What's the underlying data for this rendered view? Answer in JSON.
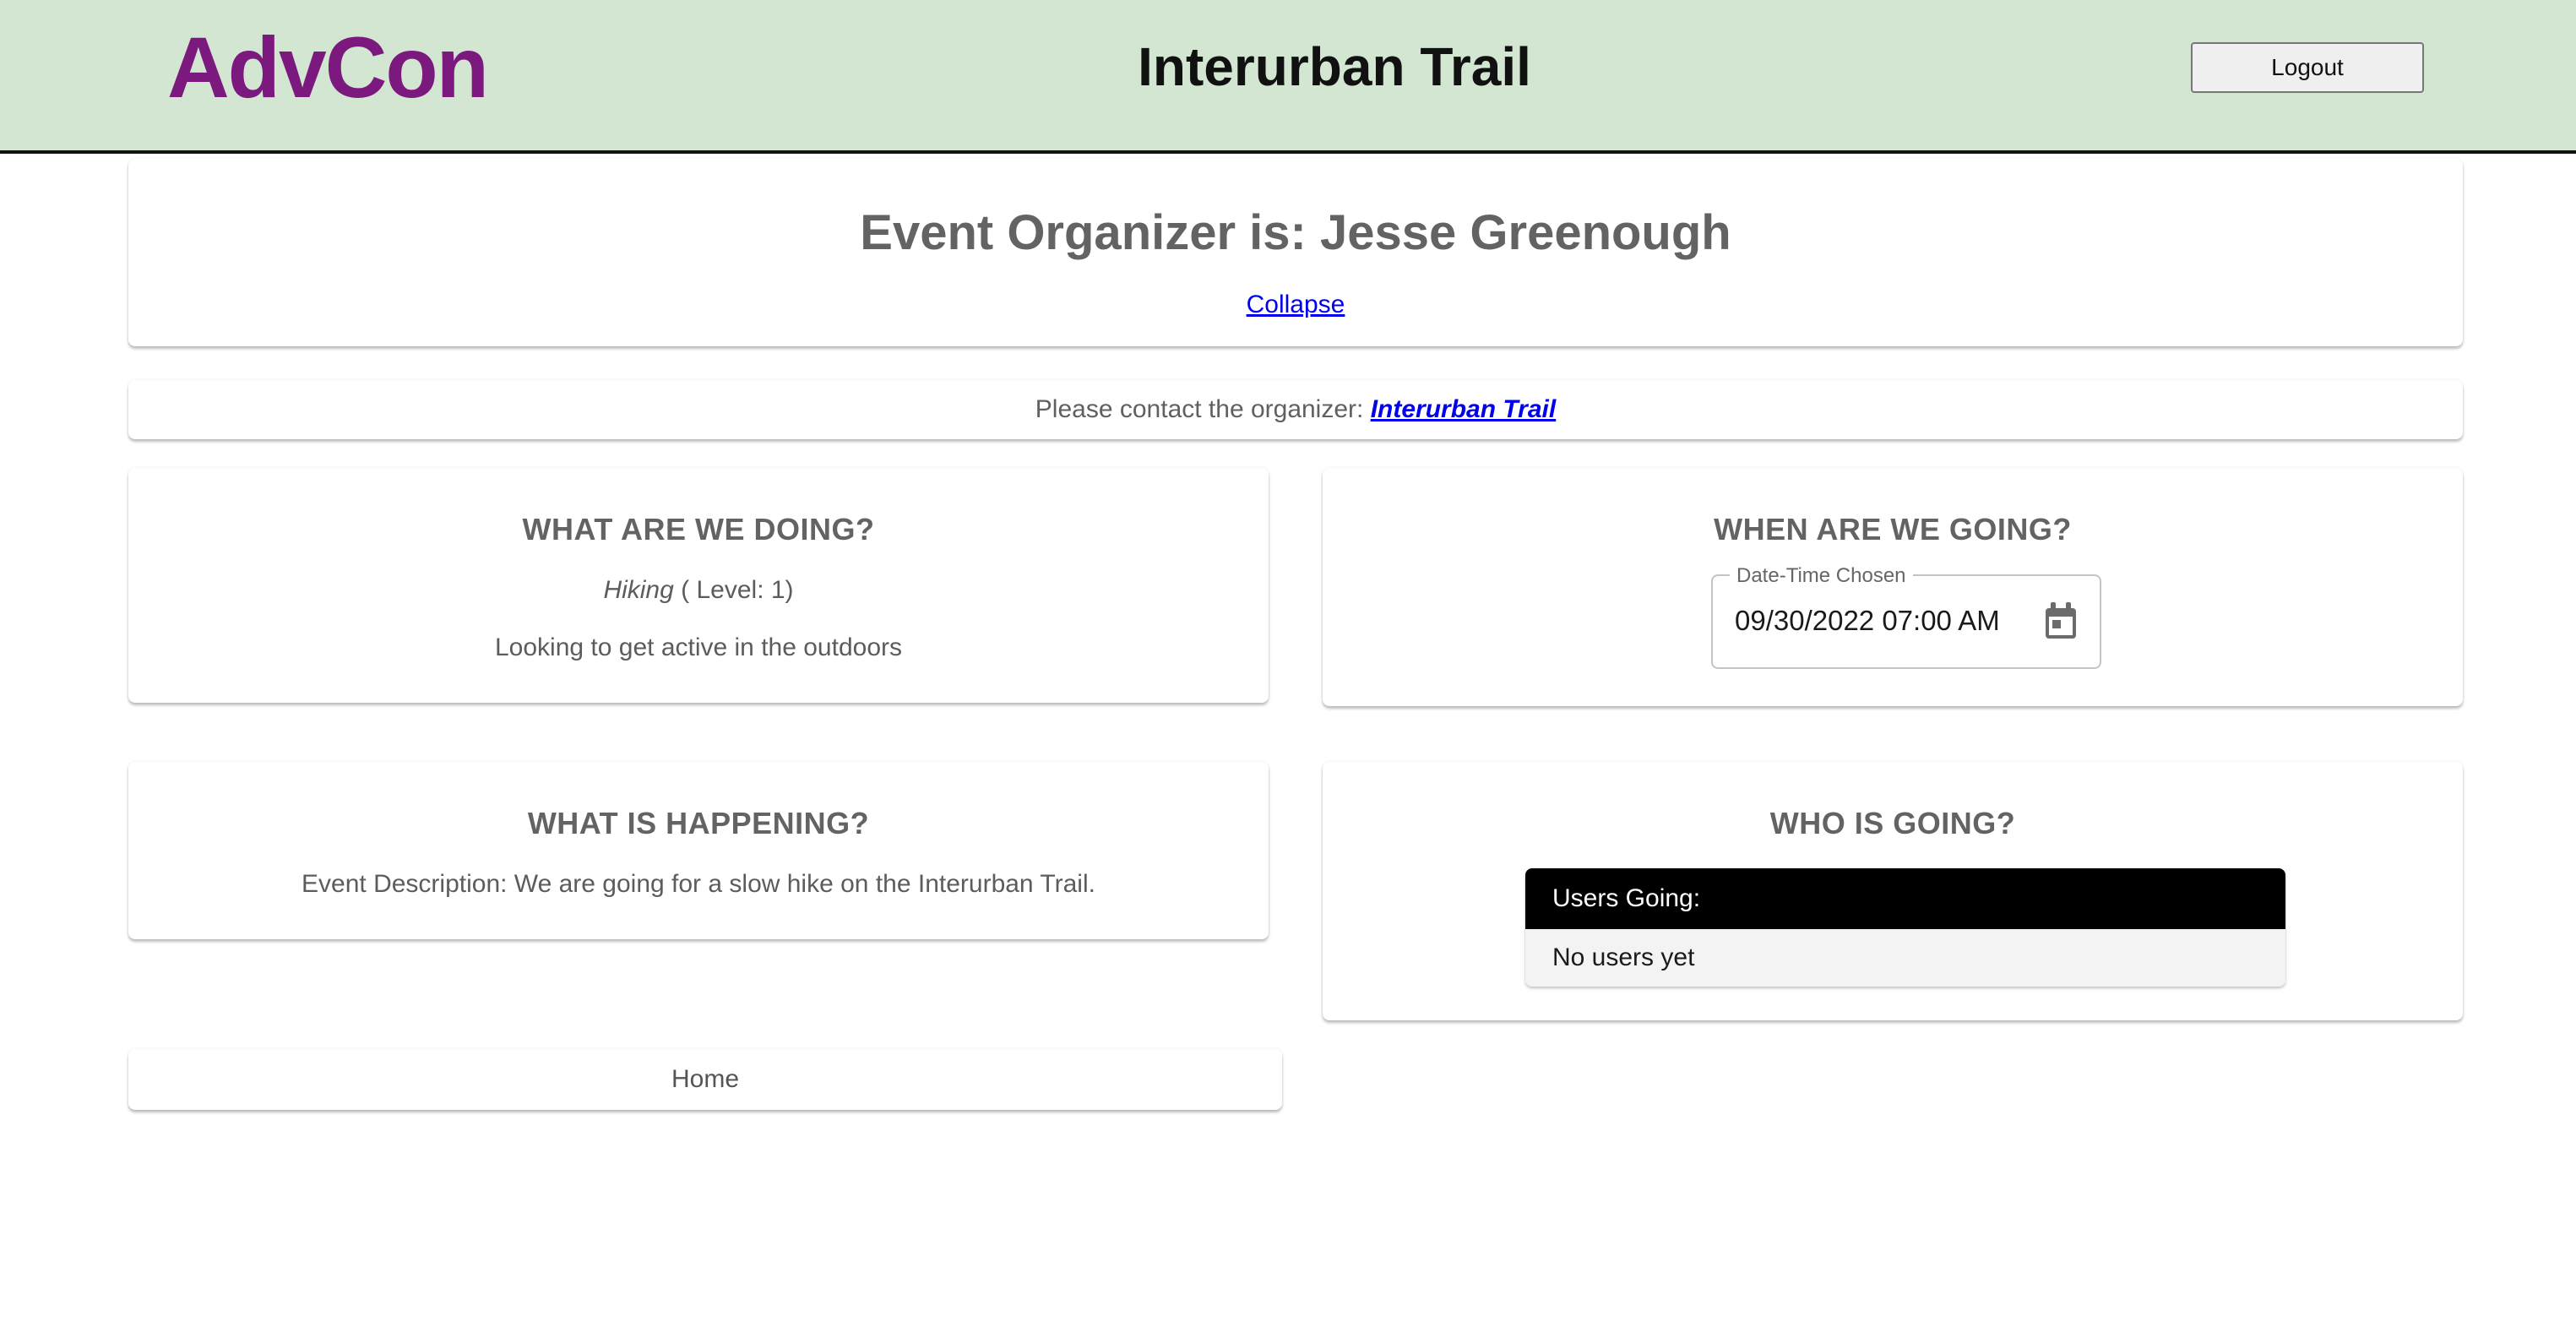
{
  "header": {
    "brand": "AdvCon",
    "title": "Interurban Trail",
    "logout_label": "Logout"
  },
  "organizer": {
    "heading": "Event Organizer is: Jesse Greenough",
    "collapse_label": "Collapse"
  },
  "contact": {
    "prefix": "Please contact the organizer: ",
    "link_label": "Interurban Trail"
  },
  "doing": {
    "title": "WHAT ARE WE DOING?",
    "activity": "Hiking",
    "level": " ( Level: 1)",
    "description": "Looking to get active in the outdoors"
  },
  "when": {
    "title": "WHEN ARE WE GOING?",
    "field_label": "Date-Time Chosen",
    "field_value": "09/30/2022 07:00 AM",
    "icon": "calendar-icon"
  },
  "happening": {
    "title": "WHAT IS HAPPENING?",
    "description": "Event Description: We are going for a slow hike on the Interurban Trail."
  },
  "who": {
    "title": "WHO IS GOING?",
    "table_header": "Users Going:",
    "empty_text": "No users yet"
  },
  "footer": {
    "home_label": "Home"
  },
  "colors": {
    "header_bg": "#d2e6d2",
    "brand": "#7b197e",
    "link": "#0000ee",
    "table_header_bg": "#000000"
  }
}
